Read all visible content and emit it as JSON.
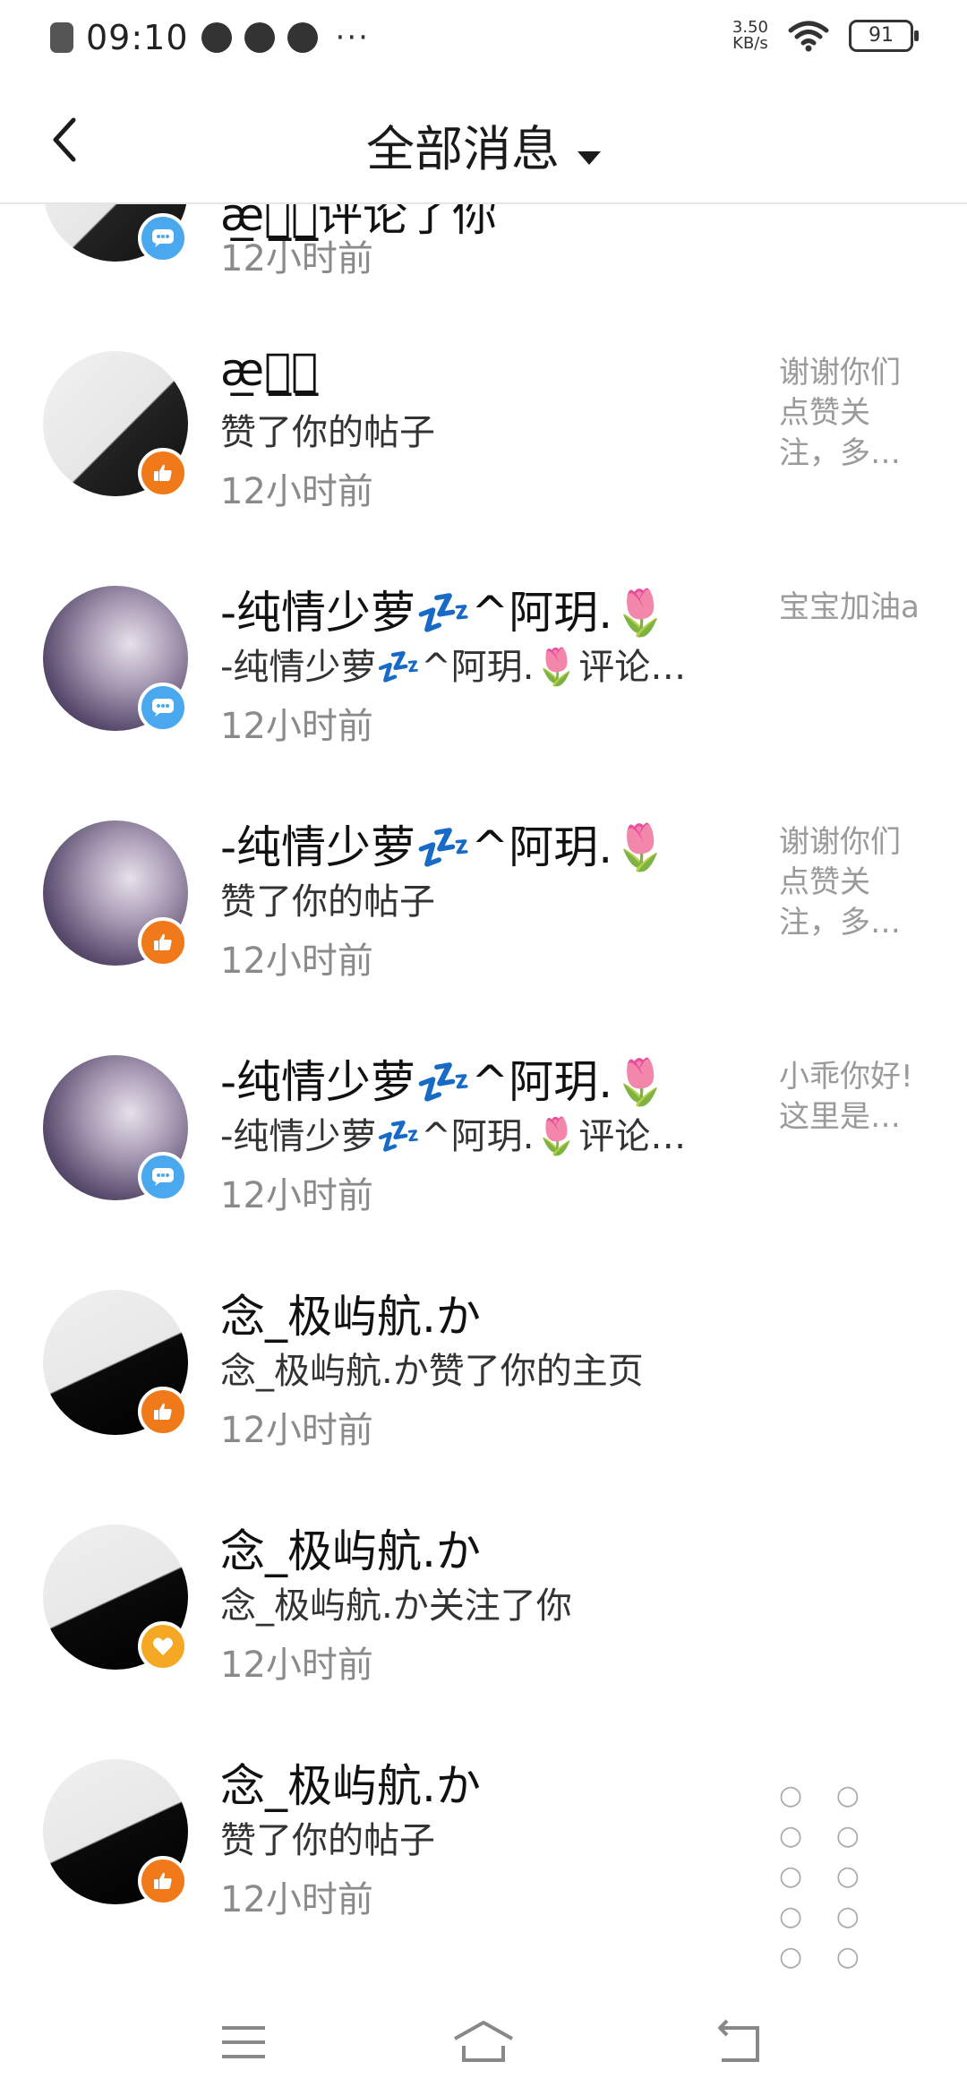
{
  "status_bar": {
    "time": "09:10",
    "speed_value": "3.50",
    "speed_unit": "KB/s",
    "battery": "91",
    "icons": [
      "x-icon",
      "play-icon",
      "cat-icon",
      "chat-icon",
      "wifi-icon",
      "battery-icon"
    ]
  },
  "header": {
    "title": "全部消息"
  },
  "items": [
    {
      "name": "æ̲怜̲瘧̲评论了你",
      "action": "",
      "time": "12小时前",
      "preview": "",
      "badge": "comment"
    },
    {
      "name": "æ̲怜̲瘧̲",
      "action": "赞了你的帖子",
      "time": "12小时前",
      "preview": "谢谢你们点赞关注，多…",
      "badge": "like"
    },
    {
      "name": "-纯情少萝💤^阿玥.🌷",
      "action": "-纯情少萝💤^阿玥.🌷评论…",
      "time": "12小时前",
      "preview": "宝宝加油a",
      "badge": "comment"
    },
    {
      "name": "-纯情少萝💤^阿玥.🌷",
      "action": "赞了你的帖子",
      "time": "12小时前",
      "preview": "谢谢你们点赞关注，多…",
      "badge": "like"
    },
    {
      "name": "-纯情少萝💤^阿玥.🌷",
      "action": "-纯情少萝💤^阿玥.🌷评论…",
      "time": "12小时前",
      "preview": "小乖你好!这里是…",
      "badge": "comment"
    },
    {
      "name": "念_极屿航.か",
      "action": "念_极屿航.か赞了你的主页",
      "time": "12小时前",
      "preview": "",
      "badge": "like"
    },
    {
      "name": "念_极屿航.か",
      "action": "念_极屿航.か关注了你",
      "time": "12小时前",
      "preview": "",
      "badge": "follow"
    },
    {
      "name": "念_极屿航.か",
      "action": "赞了你的帖子",
      "time": "12小时前",
      "preview": "○ ○ ○ ○ ○ ○ ○ ○ ○ ○ …",
      "badge": "like"
    }
  ],
  "colors": {
    "comment_badge": "#4aa8ef",
    "like_badge": "#f07a19",
    "follow_badge": "#f5a823"
  }
}
